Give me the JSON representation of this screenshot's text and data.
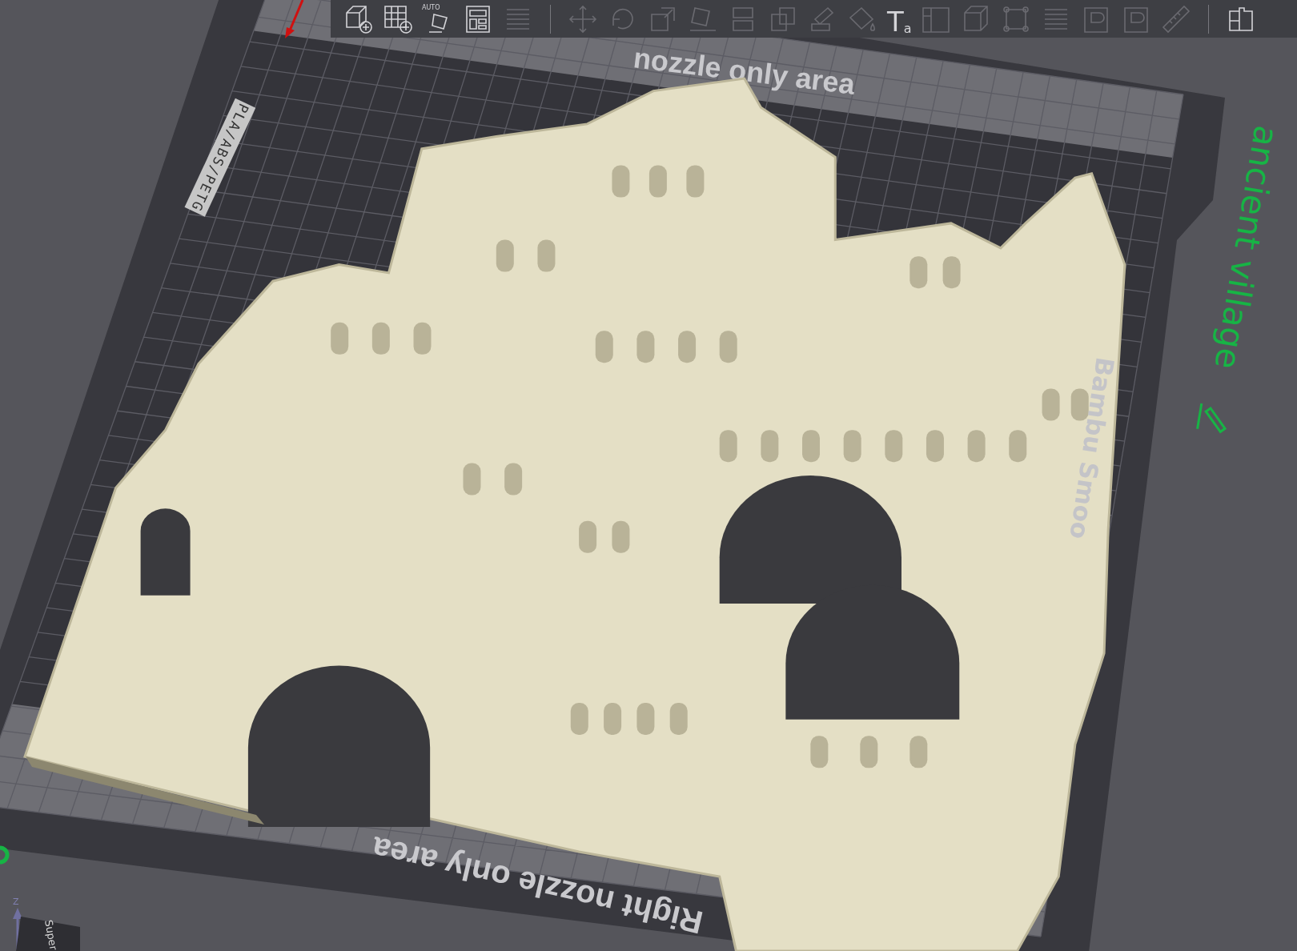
{
  "toolbar": {
    "tools": [
      {
        "kind": "add-cube",
        "disabled": false
      },
      {
        "kind": "add-grid",
        "disabled": false
      },
      {
        "kind": "auto-orient",
        "disabled": false,
        "label": "AUTO"
      },
      {
        "kind": "layout",
        "disabled": false
      },
      {
        "kind": "layers",
        "disabled": true
      },
      {
        "kind": "divider"
      },
      {
        "kind": "move",
        "disabled": true
      },
      {
        "kind": "rotate",
        "disabled": true
      },
      {
        "kind": "scale",
        "disabled": true
      },
      {
        "kind": "lay-flat",
        "disabled": true
      },
      {
        "kind": "split",
        "disabled": true
      },
      {
        "kind": "boolean",
        "disabled": true
      },
      {
        "kind": "paint",
        "disabled": true
      },
      {
        "kind": "fill",
        "disabled": true
      },
      {
        "kind": "text",
        "disabled": false,
        "big": "T",
        "small": "a"
      },
      {
        "kind": "emboss",
        "disabled": true
      },
      {
        "kind": "cube",
        "disabled": true
      },
      {
        "kind": "frame",
        "disabled": true
      },
      {
        "kind": "layers",
        "disabled": true
      },
      {
        "kind": "plate",
        "disabled": true
      },
      {
        "kind": "plate",
        "disabled": true
      },
      {
        "kind": "ruler",
        "disabled": true
      },
      {
        "kind": "divider"
      },
      {
        "kind": "assembly",
        "disabled": false
      }
    ]
  },
  "plate": {
    "top_area_label": "nozzle only area",
    "bottom_area_label": "Right nozzle only area",
    "filament_label": "PLA/ABS/PETG",
    "plate_type_label": "Bambu Smoo"
  },
  "object_name": "ancient village",
  "axes": {
    "z_label": "Z"
  },
  "view_cube": {
    "face_label": "Super"
  }
}
